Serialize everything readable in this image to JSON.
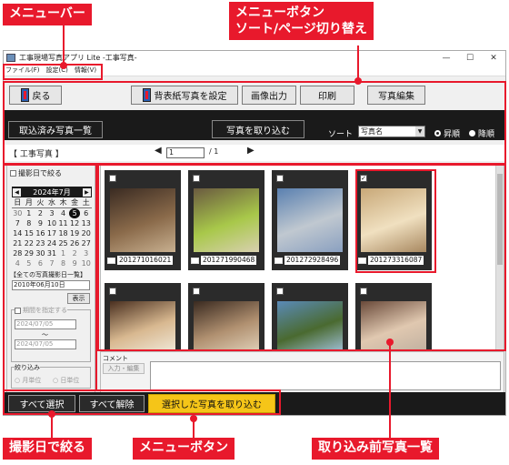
{
  "annotations": {
    "menubar": "メニューバー",
    "menu_buttons_top": "メニューボタン\nソート/ページ切り替え",
    "filter_by_date": "撮影日で絞る",
    "menu_buttons_bottom": "メニューボタン",
    "photo_list": "取り込み前写真一覧"
  },
  "window": {
    "title": "工事現場写真アプリ Lite -工事写真-",
    "controls": [
      "—",
      "☐",
      "✕"
    ]
  },
  "menu": [
    "ファイル(F)",
    "設定(C)",
    "情報(V)"
  ],
  "toolbar": {
    "back": "戻る",
    "set_wallpaper": "背表紙写真を設定",
    "image_output": "画像出力",
    "print": "印刷",
    "photo_edit": "写真編集"
  },
  "darkband": {
    "imported_list": "取込済み写真一覧",
    "import_photos": "写真を取り込む",
    "sort_label": "ソート",
    "sort_value": "写真名",
    "asc": "昇順",
    "desc": "降順",
    "order_selected": "asc"
  },
  "nav": {
    "section_title": "【 工事写真 】",
    "prev": "◀",
    "next": "▶",
    "page": "1",
    "total": "/ 1"
  },
  "filter": {
    "by_date_label": "撮影日で絞る",
    "calendar": {
      "month_label": "2024年7月",
      "weekdays": [
        "日",
        "月",
        "火",
        "水",
        "木",
        "金",
        "土"
      ],
      "weeks": [
        [
          "30",
          "1",
          "2",
          "3",
          "4",
          "5",
          "6"
        ],
        [
          "7",
          "8",
          "9",
          "10",
          "11",
          "12",
          "13"
        ],
        [
          "14",
          "15",
          "16",
          "17",
          "18",
          "19",
          "20"
        ],
        [
          "21",
          "22",
          "23",
          "24",
          "25",
          "26",
          "27"
        ],
        [
          "28",
          "29",
          "30",
          "31",
          "1",
          "2",
          "3"
        ],
        [
          "4",
          "5",
          "6",
          "7",
          "8",
          "9",
          "10"
        ]
      ],
      "selected_day": "5"
    },
    "all_dates_label": "【全ての写真撮影日一覧】",
    "date_select": "2010年06月10日",
    "show_button": "表示",
    "period_label": "期間を指定する",
    "period_from": "2024/07/05",
    "period_sep": "〜",
    "period_to": "2024/07/05",
    "narrow_label": "絞り込み",
    "by_month": "月単位",
    "by_day": "日単位"
  },
  "photos": [
    {
      "name": "201271016021",
      "checked": false,
      "palette": "#3a2b22,#8a6a4a,#c8b090"
    },
    {
      "name": "201271990468",
      "checked": false,
      "palette": "#6a5a40,#a8c84a,#d8d0b0"
    },
    {
      "name": "201272928496",
      "checked": false,
      "palette": "#5a80b0,#c0c8d0,#8aa0c0"
    },
    {
      "name": "201273316087",
      "checked": true,
      "palette": "#c8a878,#f0e0c0,#a88860"
    },
    {
      "name": "",
      "checked": false,
      "palette": "#4a3020,#d8b890,#f0e8d8"
    },
    {
      "name": "",
      "checked": false,
      "palette": "#3a2a20,#b09070,#e0d0b8"
    },
    {
      "name": "",
      "checked": false,
      "palette": "#5a8ab8,#4a6a30,#a0c0d8"
    },
    {
      "name": "",
      "checked": false,
      "palette": "#6a4a3a,#e0c8b0,#c0b0a0"
    }
  ],
  "comment": {
    "label": "コメント",
    "edit_button": "入力・編集"
  },
  "bottom": {
    "select_all": "すべて選択",
    "deselect_all": "すべて解除",
    "import_selected": "選択した写真を取り込む"
  },
  "colors": {
    "annotation_red": "#e8192c",
    "accent_yellow": "#f5c518",
    "dark_band": "#1a1a1a"
  }
}
